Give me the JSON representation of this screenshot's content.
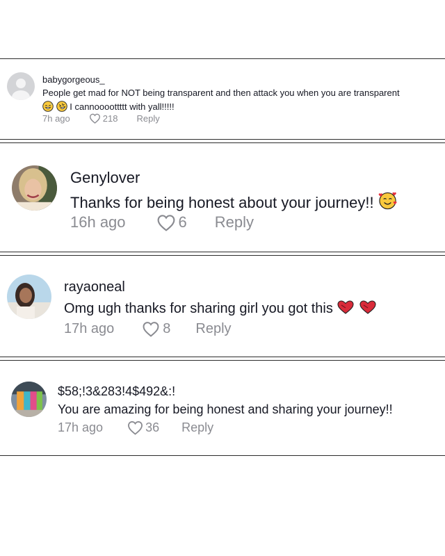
{
  "comments": [
    {
      "username": "babygorgeous_",
      "text": "People get mad for NOT being transparent and then attack you when you are transparent",
      "text_line2": "I cannoooottttt with yall!!!!!",
      "time": "7h ago",
      "likes": "218",
      "reply": "Reply",
      "avatar": "default-avatar",
      "emojis": [
        "grinning-sweat-emoji",
        "rolling-laughing-emoji"
      ]
    },
    {
      "username": "Genylover",
      "text": "Thanks for being honest about your journey!!",
      "time": "16h ago",
      "likes": "6",
      "reply": "Reply",
      "avatar": "user-photo",
      "emojis": [
        "smiling-hearts-emoji"
      ]
    },
    {
      "username": "rayaoneal",
      "text": "Omg ugh thanks for sharing girl you got this",
      "time": "17h ago",
      "likes": "8",
      "reply": "Reply",
      "avatar": "user-photo",
      "emojis": [
        "heart-exclamation-emoji",
        "heart-exclamation-emoji"
      ]
    },
    {
      "username": "$58;!3&283!4$492&:!",
      "text": "You are amazing for being honest and sharing your journey!!",
      "time": "17h ago",
      "likes": "36",
      "reply": "Reply",
      "avatar": "user-photo"
    }
  ],
  "colors": {
    "text": "#161823",
    "meta": "#8a8b91",
    "rule": "#2b2b2b",
    "heart_emoji": "#d92b3a"
  }
}
